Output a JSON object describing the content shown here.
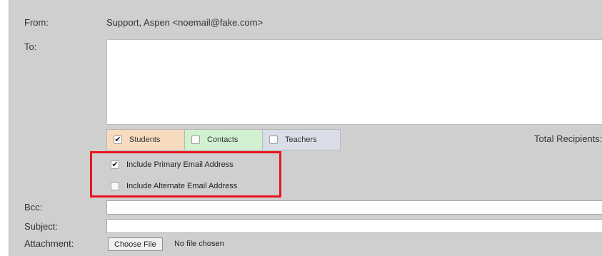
{
  "from": {
    "label": "From:",
    "value": "Support, Aspen  <noemail@fake.com>"
  },
  "to": {
    "label": "To:"
  },
  "tabs": [
    {
      "label": "Students",
      "checked": true
    },
    {
      "label": "Contacts",
      "checked": false
    },
    {
      "label": "Teachers",
      "checked": false
    }
  ],
  "total_recipients_label": "Total Recipients: (",
  "options": [
    {
      "label": "Include Primary Email Address",
      "checked": true
    },
    {
      "label": "Include Alternate Email Address",
      "checked": false
    }
  ],
  "bcc": {
    "label": "Bcc:",
    "value": ""
  },
  "subject": {
    "label": "Subject:",
    "value": ""
  },
  "attachment": {
    "label": "Attachment:",
    "button_label": "Choose File",
    "status": "No file chosen"
  },
  "colors": {
    "highlight": "#e8141c",
    "students_tab": "#f7dbbf",
    "contacts_tab": "#d2f1d0",
    "teachers_tab": "#d9dde7"
  }
}
